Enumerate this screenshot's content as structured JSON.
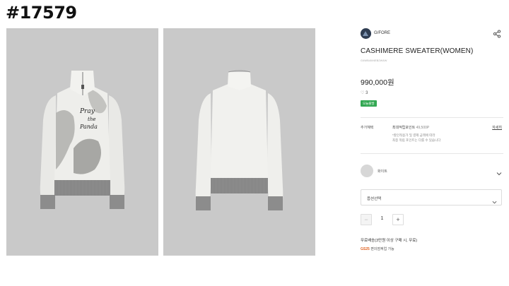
{
  "post_number": "#17579",
  "product": {
    "brand": "G/FORE",
    "title": "CASHIMERE SWEATER(WOMEN)",
    "code": "G4WB4W4EB2W4W",
    "price": "990,000원",
    "wish_count": "3",
    "badge": "오늘출발"
  },
  "benefits": {
    "label": "추가혜택",
    "points_label": "최대적립포인트",
    "points_amount": "49,500P",
    "note_line1": "*할인적용가 및 결제 금액에 따라",
    "note_line2": "최종 적립 포인트는 다를 수 있습니다",
    "detail_link": "자세히"
  },
  "color_option": {
    "label": "화이트",
    "swatch_color": "#d7d7d7"
  },
  "option_select": {
    "placeholder": "옵션선택"
  },
  "quantity": {
    "minus": "−",
    "value": "1",
    "plus": "+"
  },
  "shipping": {
    "free_shipping": "무료배송(3만원 이상 구매 시, 무료)",
    "pickup_brand": "GS25",
    "pickup_text": "편의점픽업 가능"
  },
  "icons": {
    "share": "share-icon",
    "heart": "heart-icon",
    "chevron": "chevron-down-icon"
  },
  "colors": {
    "badge": "#33a853",
    "photo_background": "#c9c9c9"
  }
}
